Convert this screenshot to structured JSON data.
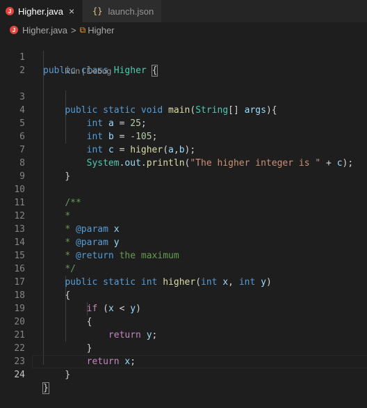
{
  "tabs": [
    {
      "label": "Higher.java",
      "icon": "java-icon",
      "active": true
    },
    {
      "label": "launch.json",
      "icon": "json-braces-icon",
      "active": false
    }
  ],
  "tab_close_glyph": "×",
  "breadcrumb": {
    "file": "Higher.java",
    "separator": ">",
    "symbol": "Higher"
  },
  "codelens": {
    "text": "Run | Debug"
  },
  "line_numbers": [
    "1",
    "2",
    "3",
    "4",
    "5",
    "6",
    "7",
    "8",
    "9",
    "10",
    "11",
    "12",
    "13",
    "14",
    "15",
    "16",
    "17",
    "18",
    "19",
    "20",
    "21",
    "22",
    "23",
    "24"
  ],
  "colors": {
    "background": "#1e1e1e",
    "keyword": "#569cd6",
    "type": "#4ec9b0",
    "function": "#dcdcaa",
    "variable": "#9cdcfe",
    "number": "#b5cea8",
    "string": "#ce9178",
    "comment": "#6a9955",
    "control": "#c586c0"
  },
  "code": {
    "l1": [
      "public",
      "class",
      "Higher",
      "{"
    ],
    "l3": [
      "public",
      "static",
      "void",
      "main",
      "(",
      "String",
      "[] ",
      "args",
      "){"
    ],
    "l4": [
      "int",
      "a",
      "=",
      "25",
      ";"
    ],
    "l5": [
      "int",
      "b",
      "=",
      "-105",
      ";"
    ],
    "l6": [
      "int",
      "c",
      "=",
      "higher",
      "(",
      "a",
      ",",
      "b",
      ");"
    ],
    "l7": [
      "System",
      ".",
      "out",
      ".",
      "println",
      "(",
      "\"The higher integer is \"",
      " + ",
      "c",
      ");"
    ],
    "l8": [
      "}"
    ],
    "l10": [
      "/**"
    ],
    "l11": [
      "*"
    ],
    "l12": [
      "* ",
      "@param",
      "x"
    ],
    "l13": [
      "* ",
      "@param",
      "y"
    ],
    "l14": [
      "* ",
      "@return",
      "the maximum"
    ],
    "l15": [
      "*/"
    ],
    "l16": [
      "public",
      "static",
      "int",
      "higher",
      "(",
      "int",
      "x",
      ", ",
      "int",
      "y",
      ")"
    ],
    "l17": [
      "{"
    ],
    "l18": [
      "if",
      "(",
      "x",
      " < ",
      "y",
      ")"
    ],
    "l19": [
      "{"
    ],
    "l20": [
      "return",
      "y",
      ";"
    ],
    "l21": [
      "}"
    ],
    "l22": [
      "return",
      "x",
      ";"
    ],
    "l23": [
      "}"
    ],
    "l24": [
      "}"
    ]
  }
}
